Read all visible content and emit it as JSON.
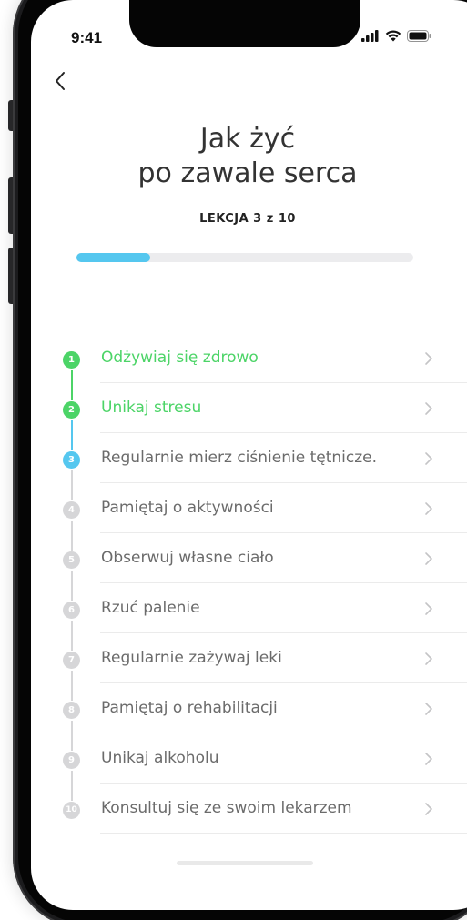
{
  "status_bar": {
    "time": "9:41",
    "icons": [
      "signal-icon",
      "wifi-icon",
      "battery-icon"
    ]
  },
  "nav": {
    "back_icon": "chevron-left-icon"
  },
  "header": {
    "title_line1": "Jak żyć",
    "title_line2": "po zawale serca",
    "lesson_label": "LEKCJA 3 z 10",
    "progress": 0.22
  },
  "colors": {
    "completed": "#4cd467",
    "current": "#55c7ef",
    "pending": "#d6d6d8",
    "pending_text": "#6b6b6b"
  },
  "lessons": [
    {
      "number": "1",
      "title": "Odżywiaj się zdrowo",
      "state": "completed"
    },
    {
      "number": "2",
      "title": "Unikaj stresu",
      "state": "completed"
    },
    {
      "number": "3",
      "title": "Regularnie mierz ciśnienie tętnicze.",
      "state": "current"
    },
    {
      "number": "4",
      "title": "Pamiętaj o aktywności",
      "state": "pending"
    },
    {
      "number": "5",
      "title": "Obserwuj własne ciało",
      "state": "pending"
    },
    {
      "number": "6",
      "title": "Rzuć palenie",
      "state": "pending"
    },
    {
      "number": "7",
      "title": "Regularnie zażywaj leki",
      "state": "pending"
    },
    {
      "number": "8",
      "title": "Pamiętaj o rehabilitacji",
      "state": "pending"
    },
    {
      "number": "9",
      "title": "Unikaj alkoholu",
      "state": "pending"
    },
    {
      "number": "10",
      "title": "Konsultuj się ze swoim lekarzem",
      "state": "pending"
    }
  ]
}
